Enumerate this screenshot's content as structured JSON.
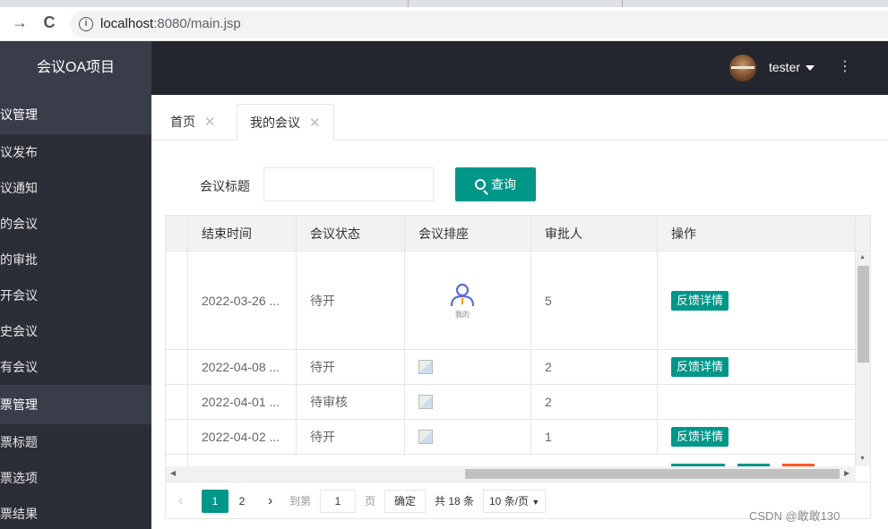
{
  "browser": {
    "url_host": "localhost",
    "url_rest": ":8080/main.jsp",
    "back_glyph": "→",
    "reload_glyph": "C"
  },
  "sidebar": {
    "title": "会议OA项目",
    "groups": [
      {
        "label": "会议管理",
        "items": [
          "会议发布",
          "会议通知",
          "我的会议",
          "我的审批",
          "待开会议",
          "历史会议",
          "所有会议"
        ]
      },
      {
        "label": "投票管理",
        "items": [
          "投票标题",
          "投票选项",
          "投票结果"
        ]
      }
    ]
  },
  "header": {
    "username": "tester",
    "more_glyph": "⋮"
  },
  "tabs": [
    {
      "label": "首页",
      "close": "✕"
    },
    {
      "label": "我的会议",
      "close": "✕"
    }
  ],
  "search": {
    "label": "会议标题",
    "value": "",
    "button_label": "查询"
  },
  "table": {
    "columns": [
      "结束时间",
      "会议状态",
      "会议排座",
      "审批人",
      "操作"
    ],
    "rows": [
      {
        "end": "2022-03-26 ...",
        "status": "待开",
        "seat": "我的",
        "approver": "5",
        "action": "反馈详情"
      },
      {
        "end": "2022-04-08 ...",
        "status": "待开",
        "seat": "",
        "approver": "2",
        "action": "反馈详情"
      },
      {
        "end": "2022-04-01 ...",
        "status": "待审核",
        "seat": "",
        "approver": "2",
        "action": ""
      },
      {
        "end": "2022-04-02 ...",
        "status": "待开",
        "seat": "",
        "approver": "1",
        "action": "反馈详情"
      }
    ],
    "colors": {
      "accent": "#009688",
      "danger": "#ff5722"
    }
  },
  "pager": {
    "pages": [
      "1",
      "2"
    ],
    "current": "1",
    "goto_label": "到第",
    "goto_value": "1",
    "page_label": "页",
    "confirm_label": "确定",
    "total_label": "共 18 条",
    "size_label": "10 条/页"
  },
  "watermark": "CSDN @敢敢130"
}
